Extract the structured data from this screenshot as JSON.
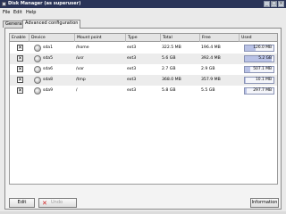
{
  "window": {
    "title": "Disk Manager (as superuser)"
  },
  "titlebar_buttons": {
    "minimize": "_",
    "maximize": "□",
    "close": "×"
  },
  "menu": [
    "File",
    "Edit",
    "Help"
  ],
  "tabs": [
    "General",
    "Advanced configuration"
  ],
  "active_tab": "General",
  "table": {
    "columns": [
      "Enable",
      "Device",
      "Mount point",
      "Type",
      "Total",
      "Free",
      "Used"
    ],
    "rows": [
      {
        "enabled": true,
        "device": "sda1",
        "mount": "/home",
        "type": "ext3",
        "total": "322.5 MB",
        "free": "196.4 MB",
        "used": "126.0 MB",
        "used_fraction": 0.39
      },
      {
        "enabled": true,
        "device": "sda5",
        "mount": "/usr",
        "type": "ext3",
        "total": "5.6 GB",
        "free": "392.4 MB",
        "used": "5.2 GB",
        "used_fraction": 0.93
      },
      {
        "enabled": true,
        "device": "sda6",
        "mount": "/var",
        "type": "ext3",
        "total": "2.7 GB",
        "free": "2.9 GB",
        "used": "507.1 MB",
        "used_fraction": 0.18
      },
      {
        "enabled": true,
        "device": "sda8",
        "mount": "/tmp",
        "type": "ext3",
        "total": "368.0 MB",
        "free": "357.9 MB",
        "used": "10.1 MB",
        "used_fraction": 0.03
      },
      {
        "enabled": true,
        "device": "sda9",
        "mount": "/",
        "type": "ext3",
        "total": "5.8 GB",
        "free": "5.5 GB",
        "used": "297.7 MB",
        "used_fraction": 0.05
      }
    ]
  },
  "checkbox_mark": "✕",
  "buttons": {
    "edit": "Edit",
    "undo": "Undo",
    "information": "Information"
  },
  "colors": {
    "titlebar": "#2a3458",
    "usage_fill": "#b9c2e6",
    "undo_icon": "#d02020"
  }
}
